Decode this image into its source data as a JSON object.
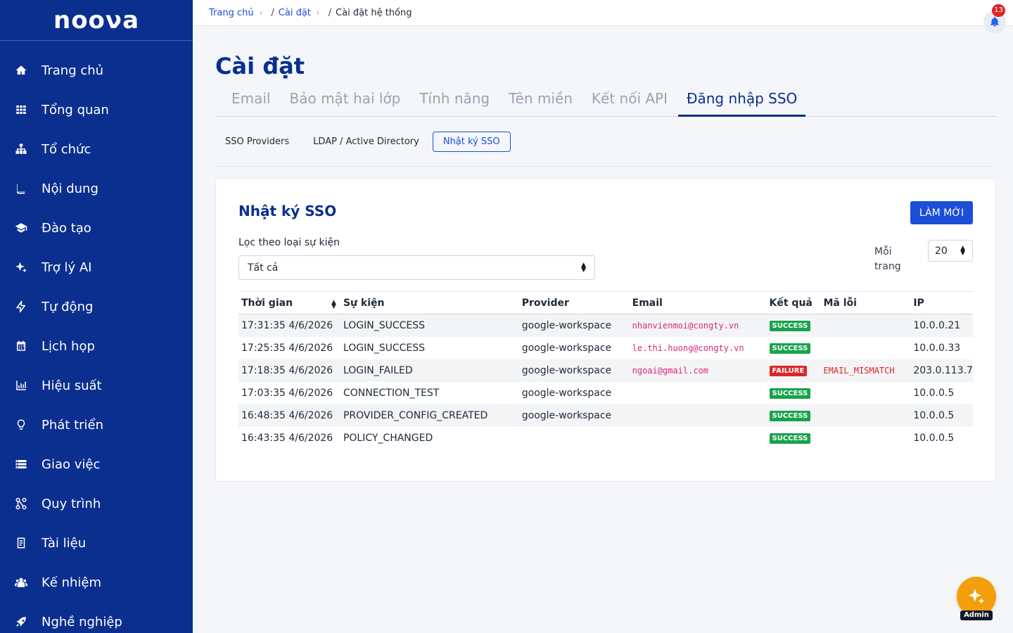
{
  "app": {
    "logo": "nooνa"
  },
  "sidebar": {
    "items": [
      {
        "label": "Trang chủ",
        "icon": "home-icon"
      },
      {
        "label": "Tổng quan",
        "icon": "grid-icon"
      },
      {
        "label": "Tổ chức",
        "icon": "org-chart-icon"
      },
      {
        "label": "Nội dung",
        "icon": "book-icon"
      },
      {
        "label": "Đào tạo",
        "icon": "graduation-cap-icon"
      },
      {
        "label": "Trợ lý AI",
        "icon": "sparkle-icon"
      },
      {
        "label": "Tự động",
        "icon": "bolt-icon"
      },
      {
        "label": "Lịch họp",
        "icon": "calendar-icon"
      },
      {
        "label": "Hiệu suất",
        "icon": "bar-chart-icon"
      },
      {
        "label": "Phát triển",
        "icon": "lightbulb-icon"
      },
      {
        "label": "Giao việc",
        "icon": "tasks-icon"
      },
      {
        "label": "Quy trình",
        "icon": "workflow-icon"
      },
      {
        "label": "Tài liệu",
        "icon": "document-icon"
      },
      {
        "label": "Kế nhiệm",
        "icon": "users-icon"
      },
      {
        "label": "Nghề nghiệp",
        "icon": "rocket-icon"
      }
    ]
  },
  "breadcrumb": {
    "home": "Trang chủ",
    "settings": "Cài đặt",
    "current": "Cài đặt hệ thống",
    "slash": "/"
  },
  "notifications": {
    "count": "13"
  },
  "page": {
    "title": "Cài đặt"
  },
  "tabs": [
    "Email",
    "Bảo mật hai lớp",
    "Tính năng",
    "Tên miền",
    "Kết nối API",
    "Đăng nhập SSO"
  ],
  "subtabs": [
    "SSO Providers",
    "LDAP / Active Directory",
    "Nhật ký SSO"
  ],
  "logs": {
    "title": "Nhật ký SSO",
    "refresh_label": "LÀM MỚI",
    "filter_label": "Lọc theo loại sự kiện",
    "filter_value": "Tất cả",
    "perpage_label": "Mỗi trang",
    "perpage_value": "20",
    "columns": [
      "Thời gian",
      "Sự kiện",
      "Provider",
      "Email",
      "Kết quả",
      "Mã lỗi",
      "IP"
    ],
    "rows": [
      {
        "time": "17:31:35 4/6/2026",
        "event": "LOGIN_SUCCESS",
        "provider": "google-workspace",
        "email": "nhanvienmoi@congty.vn",
        "result": "SUCCESS",
        "error": "",
        "ip": "10.0.0.21"
      },
      {
        "time": "17:25:35 4/6/2026",
        "event": "LOGIN_SUCCESS",
        "provider": "google-workspace",
        "email": "le.thi.huong@congty.vn",
        "result": "SUCCESS",
        "error": "",
        "ip": "10.0.0.33"
      },
      {
        "time": "17:18:35 4/6/2026",
        "event": "LOGIN_FAILED",
        "provider": "google-workspace",
        "email": "ngoai@gmail.com",
        "result": "FAILURE",
        "error": "EMAIL_MISMATCH",
        "ip": "203.0.113.7"
      },
      {
        "time": "17:03:35 4/6/2026",
        "event": "CONNECTION_TEST",
        "provider": "google-workspace",
        "email": "",
        "result": "SUCCESS",
        "error": "",
        "ip": "10.0.0.5"
      },
      {
        "time": "16:48:35 4/6/2026",
        "event": "PROVIDER_CONFIG_CREATED",
        "provider": "google-workspace",
        "email": "",
        "result": "SUCCESS",
        "error": "",
        "ip": "10.0.0.5"
      },
      {
        "time": "16:43:35 4/6/2026",
        "event": "POLICY_CHANGED",
        "provider": "",
        "email": "",
        "result": "SUCCESS",
        "error": "",
        "ip": "10.0.0.5"
      }
    ]
  },
  "fab": {
    "label": "Admin",
    "icon": "sparkle-icon"
  },
  "colors": {
    "sidebar": "#0b2f8f",
    "primary": "#1d4ed8",
    "success": "#16a34a",
    "failure": "#dc2626",
    "fab": "#f59e0b"
  }
}
